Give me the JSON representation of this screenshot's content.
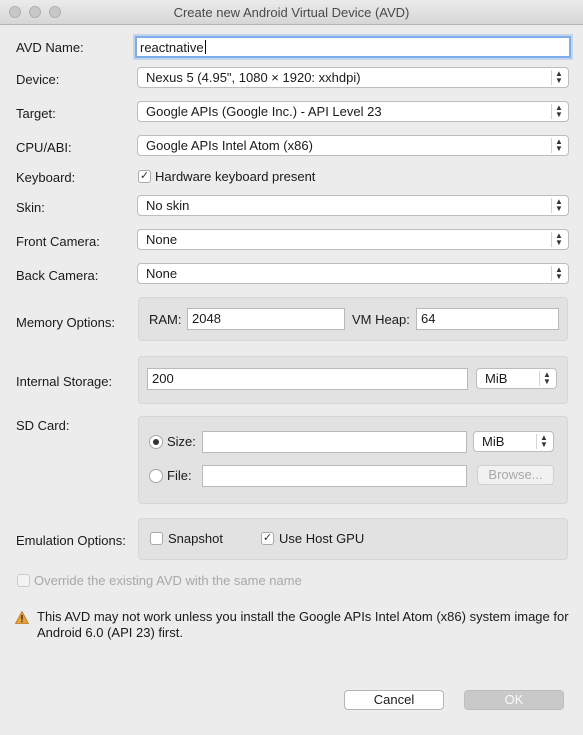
{
  "window": {
    "title": "Create new Android Virtual Device (AVD)"
  },
  "form": {
    "avd_name_label": "AVD Name:",
    "avd_name_value": "reactnative",
    "device_label": "Device:",
    "device_value": "Nexus 5 (4.95\", 1080 × 1920: xxhdpi)",
    "target_label": "Target:",
    "target_value": "Google APIs (Google Inc.) - API Level 23",
    "cpu_label": "CPU/ABI:",
    "cpu_value": "Google APIs Intel Atom (x86)",
    "keyboard_label": "Keyboard:",
    "keyboard_checkbox_label": "Hardware keyboard present",
    "keyboard_checked": true,
    "skin_label": "Skin:",
    "skin_value": "No skin",
    "front_camera_label": "Front Camera:",
    "front_camera_value": "None",
    "back_camera_label": "Back Camera:",
    "back_camera_value": "None",
    "memory_label": "Memory Options:",
    "ram_label": "RAM:",
    "ram_value": "2048",
    "vm_heap_label": "VM Heap:",
    "vm_heap_value": "64",
    "internal_storage_label": "Internal Storage:",
    "internal_storage_value": "200",
    "internal_storage_unit": "MiB",
    "sd_card_label": "SD Card:",
    "sd_size_label": "Size:",
    "sd_size_value": "",
    "sd_size_unit": "MiB",
    "sd_file_label": "File:",
    "sd_file_value": "",
    "browse_label": "Browse...",
    "emulation_label": "Emulation Options:",
    "snapshot_label": "Snapshot",
    "snapshot_checked": false,
    "host_gpu_label": "Use Host GPU",
    "host_gpu_checked": true,
    "override_label": "Override the existing AVD with the same name"
  },
  "warning": {
    "icon": "warning-triangle-icon",
    "text": "This AVD may not work unless you install the Google APIs Intel Atom (x86) system image for Android 6.0 (API 23) first."
  },
  "buttons": {
    "cancel_label": "Cancel",
    "ok_label": "OK"
  },
  "colors": {
    "focus_ring": "#7eaee9",
    "warning_icon": "#e8a23a"
  }
}
